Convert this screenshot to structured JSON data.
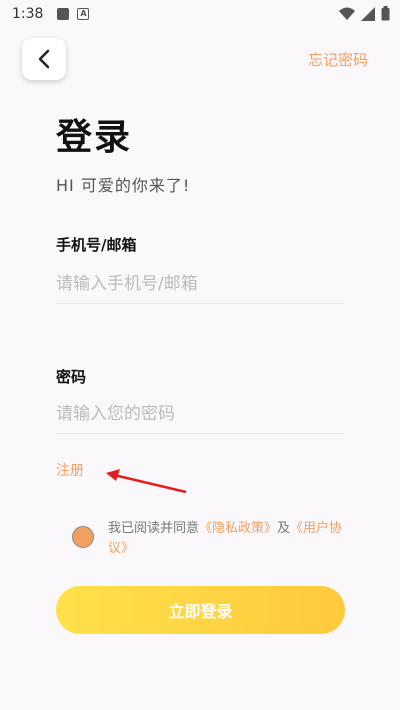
{
  "status_bar": {
    "time": "1:38"
  },
  "header": {
    "forgot_password": "忘记密码"
  },
  "title": "登录",
  "subtitle": "HI 可爱的你来了!",
  "phone_field": {
    "label": "手机号/邮箱",
    "placeholder": "请输入手机号/邮箱",
    "value": ""
  },
  "password_field": {
    "label": "密码",
    "placeholder": "请输入您的密码",
    "value": ""
  },
  "register_link": "注册",
  "agreement": {
    "prefix": "我已阅读并同意",
    "privacy": "《隐私政策》",
    "and": "及",
    "terms": "《用户协议》"
  },
  "login_button": "立即登录",
  "colors": {
    "accent": "#f2a060",
    "button_start": "#ffe14a",
    "button_end": "#ffc93e",
    "arrow": "#e02020"
  }
}
